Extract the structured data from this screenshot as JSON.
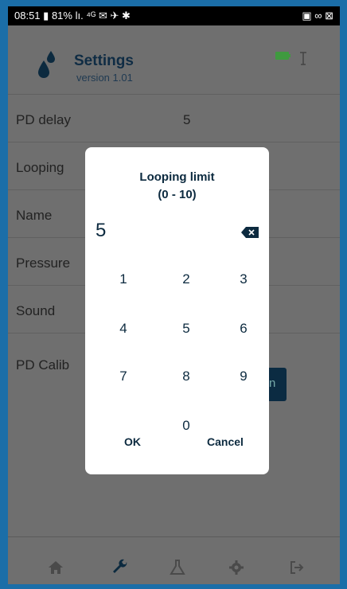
{
  "status_bar": {
    "time": "08:51",
    "battery": "81%",
    "icons_left": "lı. ⁴ᴳ ✉ ✈ ✱",
    "icons_right": "▣ ∞ ⊠"
  },
  "header": {
    "title": "Settings",
    "version": "version 1.01"
  },
  "rows": [
    {
      "label": "PD delay",
      "value": "5"
    },
    {
      "label": "Looping",
      "value": ""
    },
    {
      "label": "Name",
      "value": ""
    },
    {
      "label": "Pressure",
      "value": ""
    },
    {
      "label": "Sound",
      "value": ""
    },
    {
      "label": "PD Calib",
      "value": ""
    }
  ],
  "calibrate_button_text": "n",
  "dialog": {
    "title": "Looping limit",
    "range": "(0 - 10)",
    "value": "5",
    "keys": [
      "1",
      "2",
      "3",
      "4",
      "5",
      "6",
      "7",
      "8",
      "9",
      "0"
    ],
    "ok_label": "OK",
    "cancel_label": "Cancel"
  },
  "nav": {
    "icons": [
      "home-icon",
      "wrench-icon",
      "flask-icon",
      "gear-icon",
      "logout-icon"
    ]
  },
  "colors": {
    "screen_bg": "#6f6f6f",
    "accent": "#0c2a3f",
    "battery": "#4caf50"
  }
}
